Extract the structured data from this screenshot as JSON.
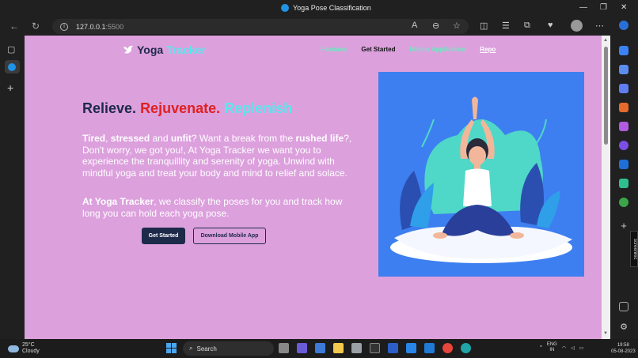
{
  "window": {
    "title": "Yoga Pose Classification",
    "minimize": "—",
    "restore": "❐",
    "close": "✕"
  },
  "toolbar": {
    "url_host": "127.0.0.1",
    "url_port": ":5500"
  },
  "page": {
    "logo_yoga": "Yoga",
    "logo_tracker": "Tracker",
    "nav": {
      "features": "Features",
      "get_started": "Get Started",
      "mobile_app": "Mobile Application",
      "repo": "Repo"
    },
    "headline": {
      "part1": "Relieve.",
      "part2": "Rejuvenate.",
      "part3": "Replenish"
    },
    "para1": {
      "tired": "Tired",
      "comma1": ", ",
      "stressed": "stressed",
      "and": " and ",
      "unfit": "unfit",
      "mid": "? Want a break from the ",
      "rushed": "rushed life",
      "rest": "?, Don't worry, we got you!, At Yoga Tracker we want you to experience the tranquillity and serenity of yoga. Unwind with mindful yoga and treat your body and mind to relief and solace."
    },
    "para2": {
      "brand": "At Yoga Tracker",
      "rest": ", we classify the poses for you and track how long you can hold each yoga pose."
    },
    "buttons": {
      "get_started": "Get Started",
      "download": "Download Mobile App"
    }
  },
  "screenrec_label": "screenrec",
  "taskbar": {
    "weather_temp": "25°C",
    "weather_desc": "Cloudy",
    "search_label": "Search",
    "lang1": "ENG",
    "lang2": "IN",
    "time": "19:58",
    "date": "05-08-2023"
  },
  "colors": {
    "page_bg": "#dca0dd",
    "brand_dark": "#1e2a4a",
    "accent_cyan": "#5ce6ec",
    "accent_red": "#e02020",
    "hero_bg": "#3d7ff0"
  }
}
